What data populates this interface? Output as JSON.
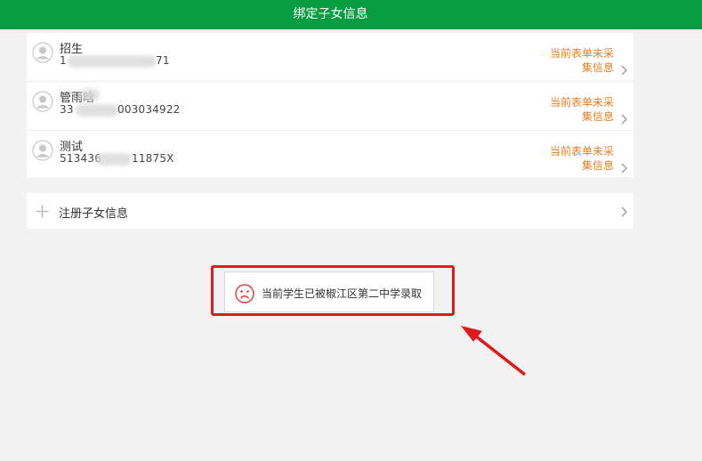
{
  "header": {
    "title": "绑定子女信息"
  },
  "children": [
    {
      "name": "招生",
      "id_prefix": "1",
      "id_suffix": "71",
      "status_line1": "当前表单未采",
      "status_line2": "集信息"
    },
    {
      "name": "管雨晗",
      "id_prefix": "33",
      "id_suffix": "003034922",
      "status_line1": "当前表单未采",
      "status_line2": "集信息"
    },
    {
      "name": "测试",
      "id_prefix": "513436",
      "id_suffix": "11875X",
      "status_line1": "当前表单未采",
      "status_line2": "集信息"
    }
  ],
  "register": {
    "label": "注册子女信息"
  },
  "toast": {
    "message": "当前学生已被椒江区第二中学录取",
    "icon": "sad-face-icon"
  },
  "colors": {
    "header_bg": "#079c3f",
    "status": "#e67e22",
    "annotation": "#e0191d"
  }
}
